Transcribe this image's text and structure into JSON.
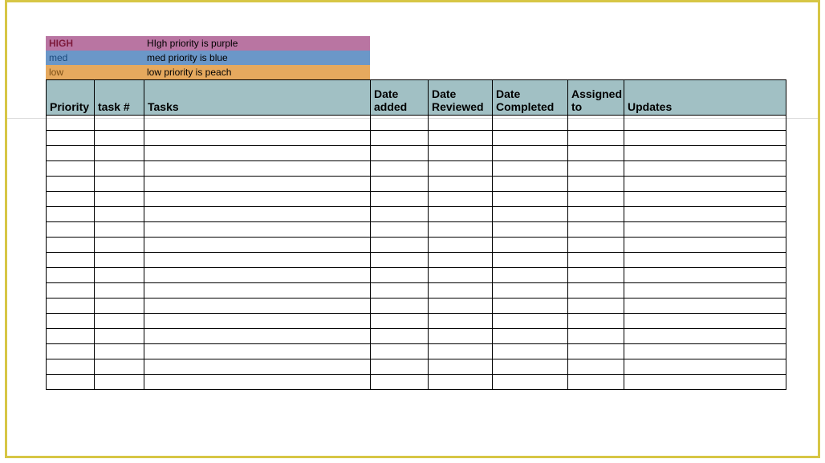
{
  "legend": {
    "high": {
      "label": "HIGH",
      "desc": "HIgh priority is purple"
    },
    "med": {
      "label": "med",
      "desc": "med priority is blue"
    },
    "low": {
      "label": "low",
      "desc": "low priority is peach"
    }
  },
  "columns": {
    "priority": "Priority",
    "task_num": "task #",
    "tasks": "Tasks",
    "date_added": "Date added",
    "date_reviewed": "Date Reviewed",
    "date_completed": "Date Completed",
    "assigned_to": "Assigned to",
    "updates": "Updates"
  },
  "rows": [
    {
      "priority": "",
      "task_num": "",
      "tasks": "",
      "date_added": "",
      "date_reviewed": "",
      "date_completed": "",
      "assigned_to": "",
      "updates": ""
    },
    {
      "priority": "",
      "task_num": "",
      "tasks": "",
      "date_added": "",
      "date_reviewed": "",
      "date_completed": "",
      "assigned_to": "",
      "updates": ""
    },
    {
      "priority": "",
      "task_num": "",
      "tasks": "",
      "date_added": "",
      "date_reviewed": "",
      "date_completed": "",
      "assigned_to": "",
      "updates": ""
    },
    {
      "priority": "",
      "task_num": "",
      "tasks": "",
      "date_added": "",
      "date_reviewed": "",
      "date_completed": "",
      "assigned_to": "",
      "updates": ""
    },
    {
      "priority": "",
      "task_num": "",
      "tasks": "",
      "date_added": "",
      "date_reviewed": "",
      "date_completed": "",
      "assigned_to": "",
      "updates": ""
    },
    {
      "priority": "",
      "task_num": "",
      "tasks": "",
      "date_added": "",
      "date_reviewed": "",
      "date_completed": "",
      "assigned_to": "",
      "updates": ""
    },
    {
      "priority": "",
      "task_num": "",
      "tasks": "",
      "date_added": "",
      "date_reviewed": "",
      "date_completed": "",
      "assigned_to": "",
      "updates": ""
    },
    {
      "priority": "",
      "task_num": "",
      "tasks": "",
      "date_added": "",
      "date_reviewed": "",
      "date_completed": "",
      "assigned_to": "",
      "updates": ""
    },
    {
      "priority": "",
      "task_num": "",
      "tasks": "",
      "date_added": "",
      "date_reviewed": "",
      "date_completed": "",
      "assigned_to": "",
      "updates": ""
    },
    {
      "priority": "",
      "task_num": "",
      "tasks": "",
      "date_added": "",
      "date_reviewed": "",
      "date_completed": "",
      "assigned_to": "",
      "updates": ""
    },
    {
      "priority": "",
      "task_num": "",
      "tasks": "",
      "date_added": "",
      "date_reviewed": "",
      "date_completed": "",
      "assigned_to": "",
      "updates": ""
    },
    {
      "priority": "",
      "task_num": "",
      "tasks": "",
      "date_added": "",
      "date_reviewed": "",
      "date_completed": "",
      "assigned_to": "",
      "updates": ""
    },
    {
      "priority": "",
      "task_num": "",
      "tasks": "",
      "date_added": "",
      "date_reviewed": "",
      "date_completed": "",
      "assigned_to": "",
      "updates": ""
    },
    {
      "priority": "",
      "task_num": "",
      "tasks": "",
      "date_added": "",
      "date_reviewed": "",
      "date_completed": "",
      "assigned_to": "",
      "updates": ""
    },
    {
      "priority": "",
      "task_num": "",
      "tasks": "",
      "date_added": "",
      "date_reviewed": "",
      "date_completed": "",
      "assigned_to": "",
      "updates": ""
    },
    {
      "priority": "",
      "task_num": "",
      "tasks": "",
      "date_added": "",
      "date_reviewed": "",
      "date_completed": "",
      "assigned_to": "",
      "updates": ""
    },
    {
      "priority": "",
      "task_num": "",
      "tasks": "",
      "date_added": "",
      "date_reviewed": "",
      "date_completed": "",
      "assigned_to": "",
      "updates": ""
    },
    {
      "priority": "",
      "task_num": "",
      "tasks": "",
      "date_added": "",
      "date_reviewed": "",
      "date_completed": "",
      "assigned_to": "",
      "updates": ""
    }
  ]
}
